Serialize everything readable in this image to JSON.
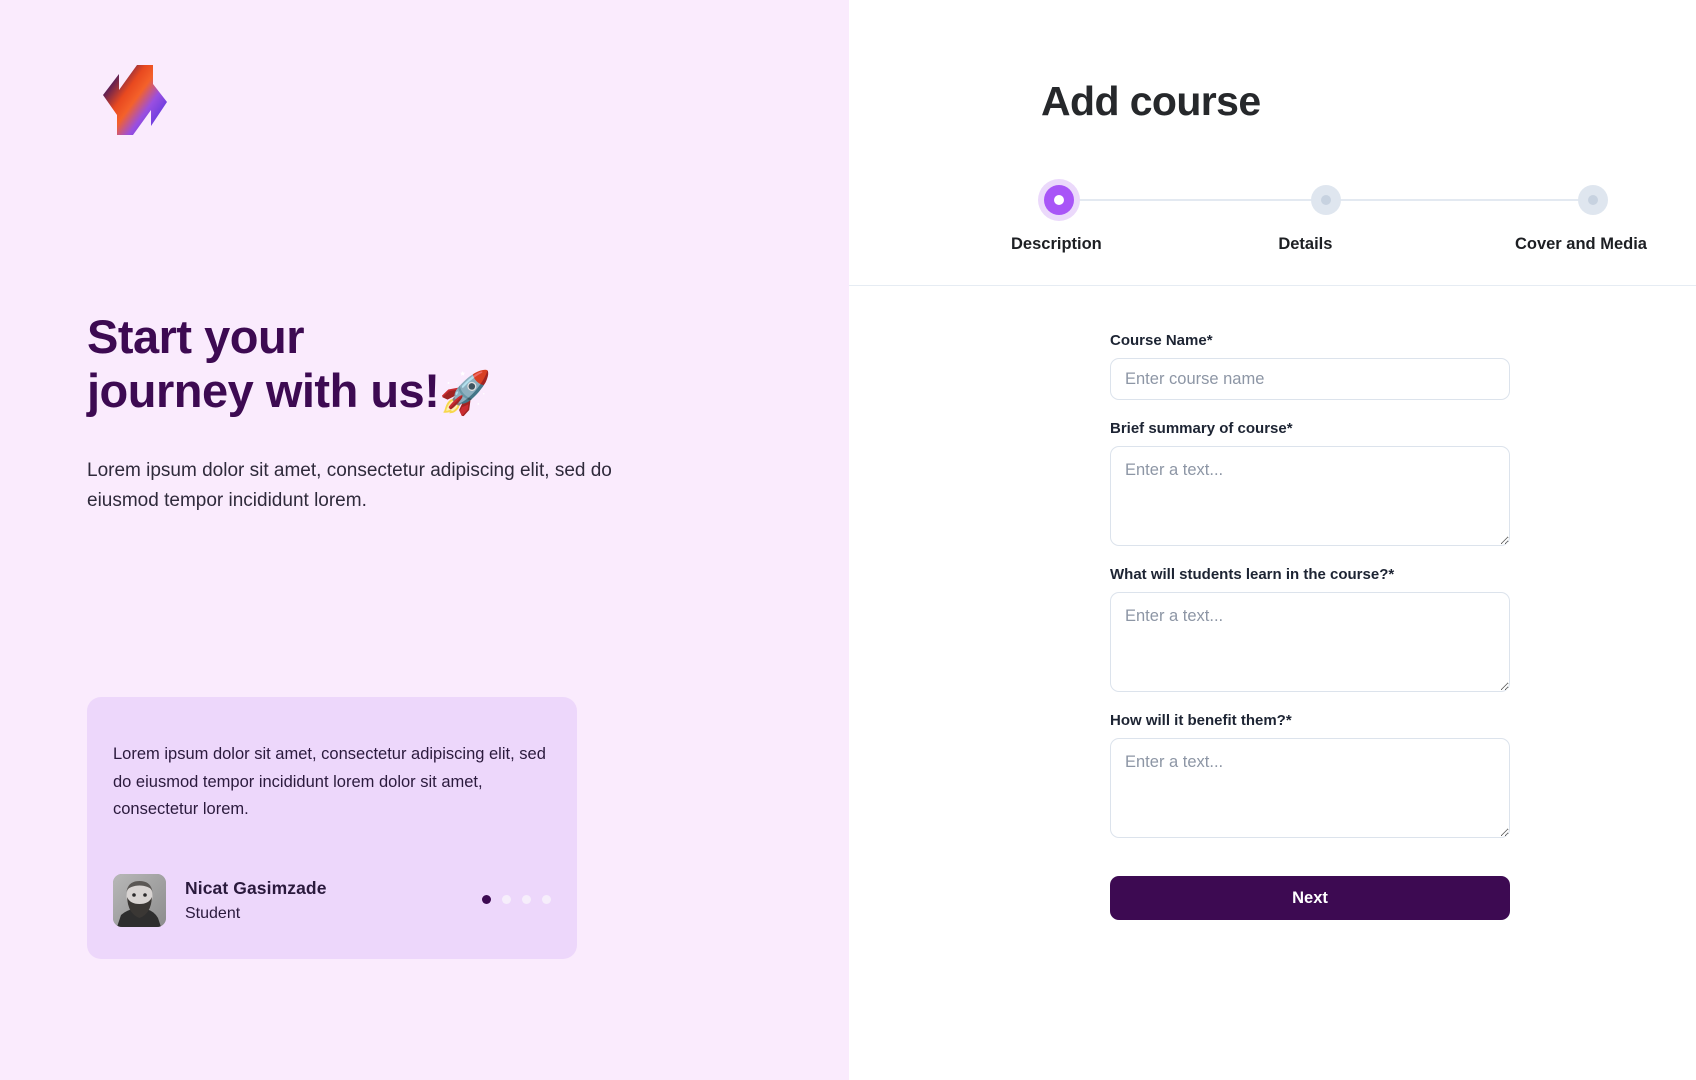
{
  "left": {
    "logo_icon": "nova-lightning-logo-icon",
    "hero": {
      "line1": "Start your",
      "line2": "journey with us!",
      "emoji": "🚀",
      "subtitle": "Lorem ipsum dolor sit amet, consectetur adipiscing elit, sed do eiusmod tempor incididunt lorem."
    },
    "testimonial": {
      "quote": "Lorem ipsum dolor sit amet, consectetur adipiscing elit, sed do eiusmod tempor incididunt lorem dolor sit amet, consectetur lorem.",
      "author_name": "Nicat Gasimzade",
      "author_role": "Student",
      "dots": [
        {
          "active": true
        },
        {
          "active": false
        },
        {
          "active": false
        },
        {
          "active": false
        }
      ]
    },
    "colors": {
      "background": "#FAEBFD",
      "card_background": "#EDD7FB",
      "heading": "#3D0A52"
    }
  },
  "right": {
    "title": "Add course",
    "stepper": {
      "steps": [
        {
          "label": "Description",
          "state": "active"
        },
        {
          "label": "Details",
          "state": "inactive"
        },
        {
          "label": "Cover and Media",
          "state": "inactive"
        }
      ],
      "active_color": "#A855F7",
      "inactive_color": "#DFE6EF"
    },
    "form": {
      "fields": [
        {
          "label": "Course Name*",
          "type": "input",
          "placeholder": "Enter course name",
          "value": ""
        },
        {
          "label": "Brief summary of course*",
          "type": "textarea",
          "placeholder": "Enter a text...",
          "value": ""
        },
        {
          "label": "What will students learn in the course?*",
          "type": "textarea",
          "placeholder": "Enter a text...",
          "value": ""
        },
        {
          "label": "How will it benefit them?*",
          "type": "textarea",
          "placeholder": "Enter a text...",
          "value": ""
        }
      ],
      "submit_label": "Next",
      "submit_color": "#3D0A52"
    }
  }
}
